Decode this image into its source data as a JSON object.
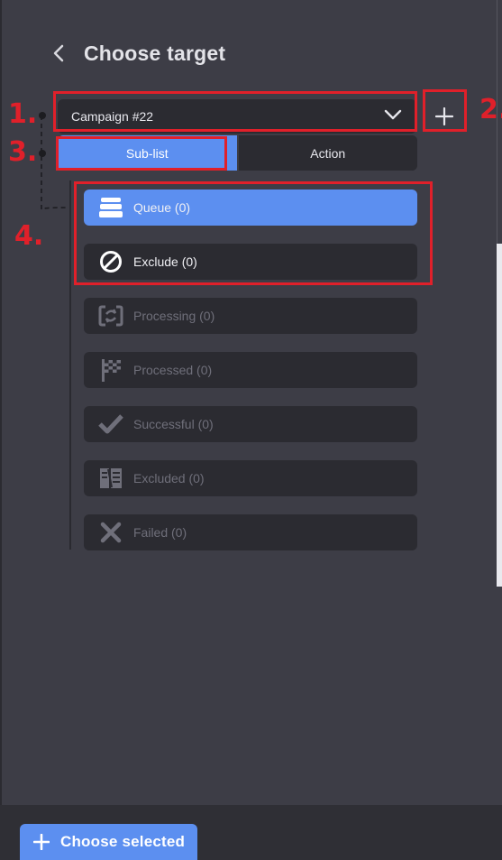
{
  "header": {
    "title": "Choose target"
  },
  "target": {
    "selected": "Campaign #22"
  },
  "tabs": [
    {
      "label": "Sub-list",
      "active": true
    },
    {
      "label": "Action",
      "active": false
    }
  ],
  "sublists": [
    {
      "label": "Queue (0)",
      "icon": "queue-stack-icon",
      "state": "selected"
    },
    {
      "label": "Exclude (0)",
      "icon": "exclude-circle-icon",
      "state": "enabled"
    },
    {
      "label": "Processing (0)",
      "icon": "processing-cycle-icon",
      "state": "disabled"
    },
    {
      "label": "Processed (0)",
      "icon": "checkered-flag-icon",
      "state": "disabled"
    },
    {
      "label": "Successful (0)",
      "icon": "check-icon",
      "state": "disabled"
    },
    {
      "label": "Excluded (0)",
      "icon": "excluded-doc-icon",
      "state": "disabled"
    },
    {
      "label": "Failed (0)",
      "icon": "x-icon",
      "state": "disabled"
    }
  ],
  "footer": {
    "button_label": "Choose selected"
  },
  "annotations": [
    "1.",
    "2.",
    "3.",
    "4."
  ],
  "colors": {
    "accent": "#5c8ff0",
    "panel": "#3d3d46",
    "card": "#2b2b31",
    "annotation": "#e0202a"
  }
}
